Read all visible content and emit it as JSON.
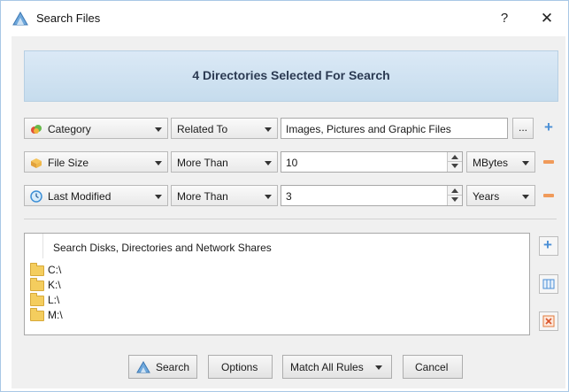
{
  "window": {
    "title": "Search Files",
    "help": "?",
    "close": "✕"
  },
  "banner": {
    "text": "4 Directories Selected For Search"
  },
  "rules": [
    {
      "field": "Category",
      "operator": "Related To",
      "value": "Images, Pictures and Graphic Files",
      "extra": "...",
      "action": "add"
    },
    {
      "field": "File Size",
      "operator": "More Than",
      "value": "10",
      "unit": "MBytes",
      "action": "remove"
    },
    {
      "field": "Last Modified",
      "operator": "More Than",
      "value": "3",
      "unit": "Years",
      "action": "remove"
    }
  ],
  "locations": {
    "header": "Search Disks, Directories and Network Shares",
    "items": [
      "C:\\",
      "K:\\",
      "L:\\",
      "M:\\"
    ]
  },
  "buttons": {
    "search": "Search",
    "options": "Options",
    "match": "Match All Rules",
    "cancel": "Cancel"
  },
  "colors": {
    "accent_plus": "#4a8fd6",
    "accent_minus": "#f09a5a",
    "banner_text": "#2b3a52"
  }
}
